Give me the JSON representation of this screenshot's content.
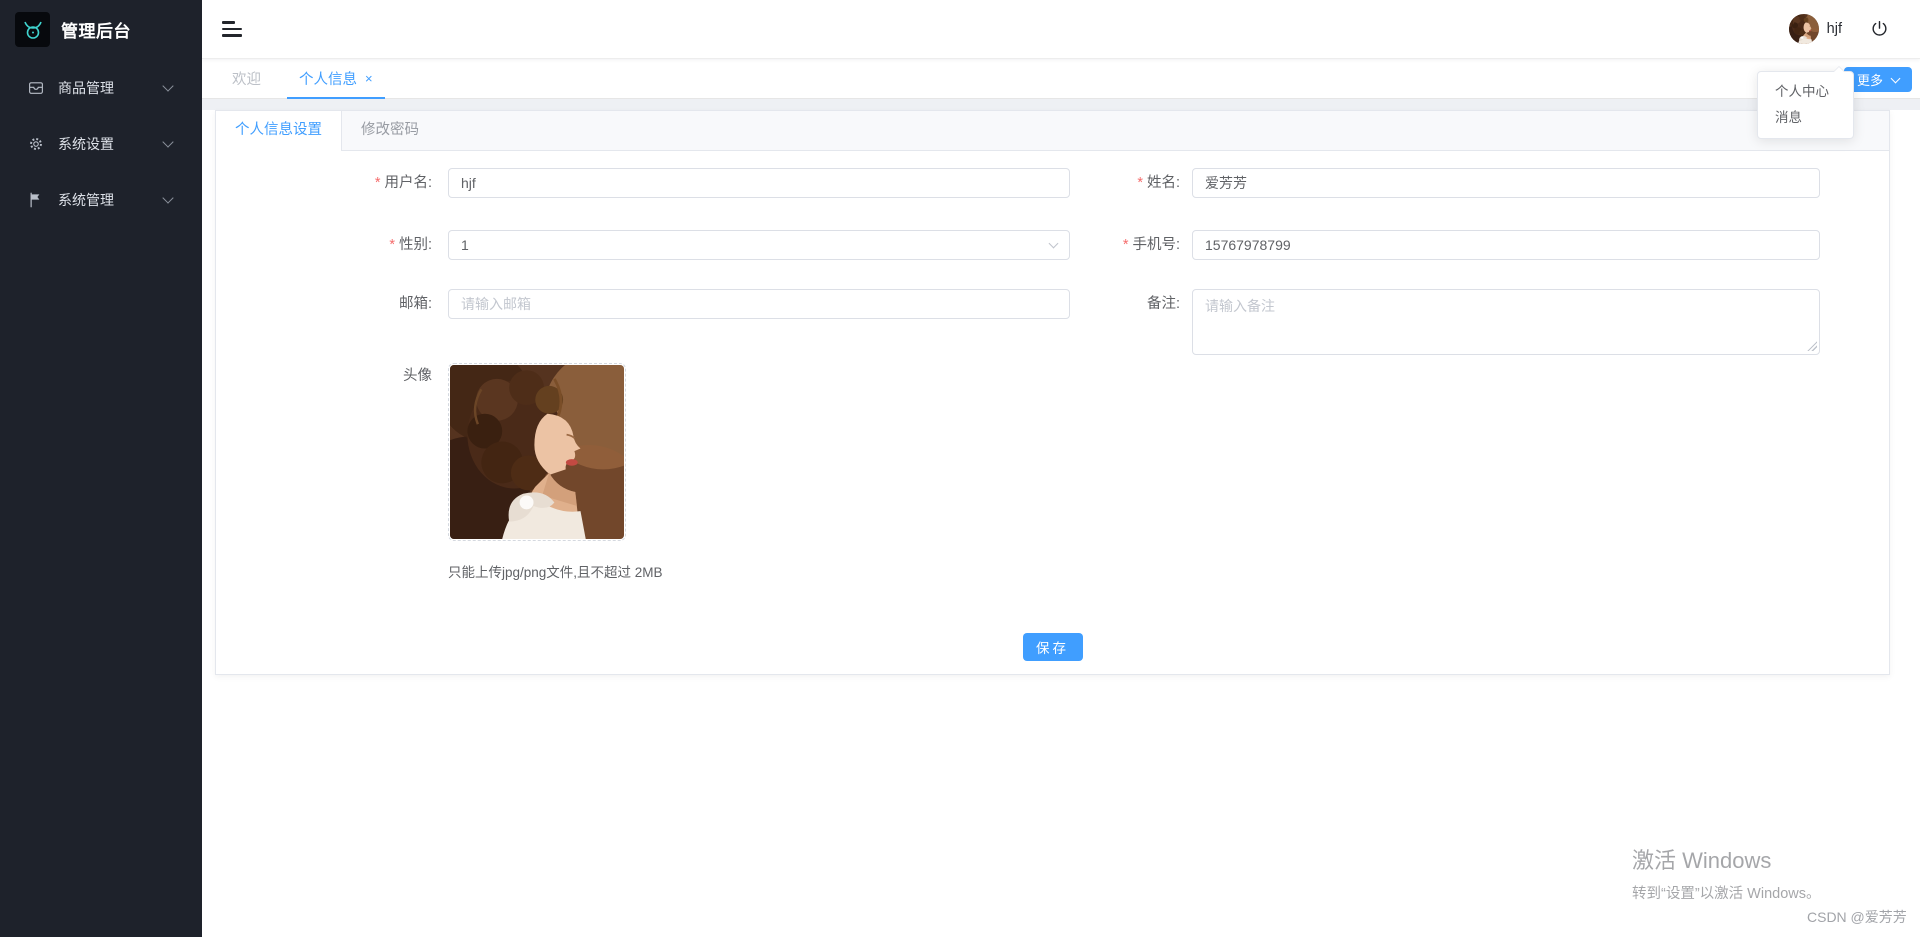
{
  "app": {
    "title": "管理后台"
  },
  "sidebar": {
    "items": [
      {
        "label": "商品管理",
        "icon": "goods-icon"
      },
      {
        "label": "系统设置",
        "icon": "gear-icon"
      },
      {
        "label": "系统管理",
        "icon": "flag-icon"
      }
    ]
  },
  "header": {
    "username": "hjf"
  },
  "tagbar": {
    "tabs": [
      {
        "label": "欢迎"
      },
      {
        "label": "个人信息",
        "close": "×"
      }
    ],
    "more_label": "更多"
  },
  "user_menu": {
    "items": [
      {
        "label": "个人中心"
      },
      {
        "label": "消息"
      }
    ]
  },
  "panel": {
    "tabs": [
      {
        "label": "个人信息设置"
      },
      {
        "label": "修改密码"
      }
    ]
  },
  "form": {
    "required_mark": "*",
    "username": {
      "label": "用户名:",
      "value": "hjf"
    },
    "name": {
      "label": "姓名:",
      "value": "爱芳芳"
    },
    "gender": {
      "label": "性别:",
      "value": "1"
    },
    "phone": {
      "label": "手机号:",
      "value": "15767978799"
    },
    "email": {
      "label": "邮箱:",
      "placeholder": "请输入邮箱"
    },
    "remark": {
      "label": "备注:",
      "placeholder": "请输入备注"
    },
    "avatar": {
      "label": "头像",
      "hint": "只能上传jpg/png文件,且不超过 2MB"
    },
    "save_label": "保存"
  },
  "watermarks": {
    "activate_title": "激活 Windows",
    "activate_sub": "转到“设置”以激活 Windows。",
    "csdn": "CSDN @爱芳芳"
  },
  "colors": {
    "accent": "#409eff",
    "sidebar_bg": "#1e222b",
    "logo_teal": "#3fd4cf",
    "required_red": "#f56c6c"
  }
}
